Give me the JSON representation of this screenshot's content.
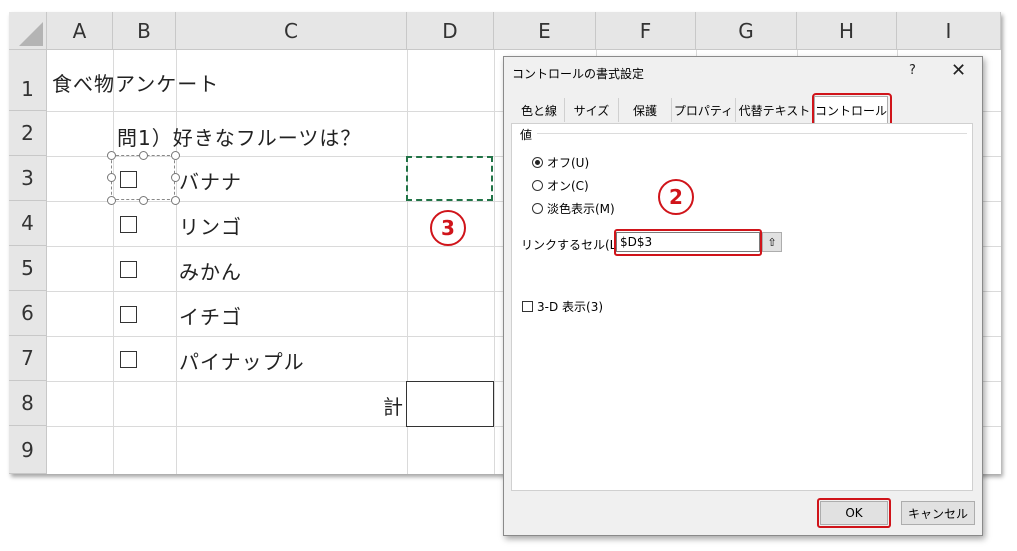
{
  "sheet": {
    "columns": [
      "A",
      "B",
      "C",
      "D",
      "E",
      "F",
      "G",
      "H",
      "I"
    ],
    "rows": [
      "1",
      "2",
      "3",
      "4",
      "5",
      "6",
      "7",
      "8",
      "9"
    ],
    "title": "食べ物アンケート",
    "question": "問1）好きなフルーツは？",
    "fruits": [
      "バナナ",
      "リンゴ",
      "みかん",
      "イチゴ",
      "パイナップル"
    ],
    "total_label": "計"
  },
  "badges": {
    "b2": "2",
    "b3": "3"
  },
  "dialog": {
    "title": "コントロールの書式設定",
    "help": "?",
    "close": "✕",
    "tabs": [
      "色と線",
      "サイズ",
      "保護",
      "プロパティ",
      "代替テキスト",
      "コントロール"
    ],
    "value_label": "値",
    "radio_off": "オフ(U)",
    "radio_on": "オン(C)",
    "radio_mixed": "淡色表示(M)",
    "link_label": "リンクするセル(L):",
    "link_value": "$D$3",
    "threed_label": "3-D 表示(3)",
    "ok": "OK",
    "cancel": "キャンセル"
  },
  "colors": {
    "accent_red": "#d0141a",
    "selection_green": "#217346"
  },
  "icons": {
    "collapse": "collapse-dialog-icon",
    "corner": "select-all-triangle-icon"
  }
}
